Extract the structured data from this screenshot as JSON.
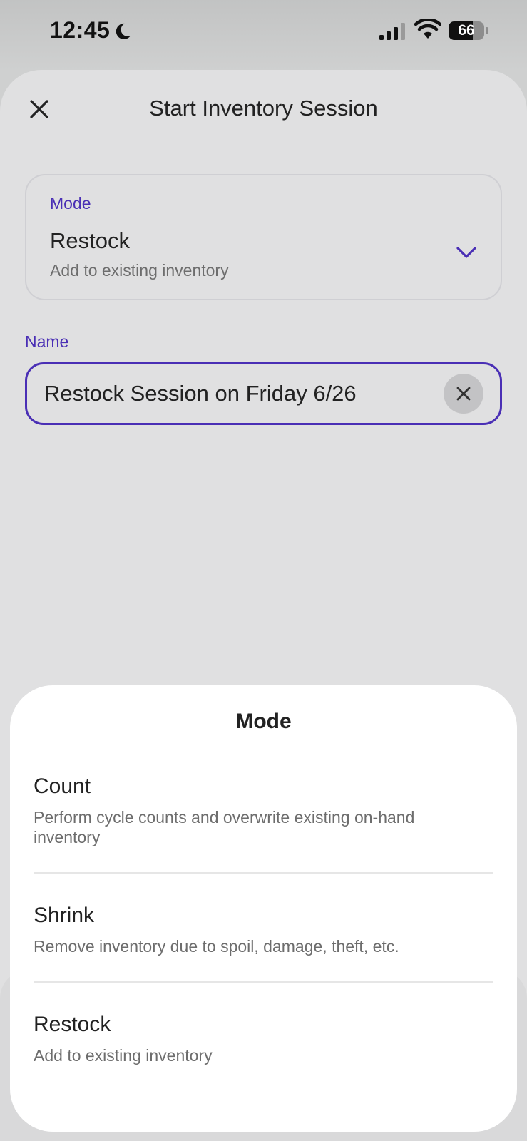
{
  "status_bar": {
    "time": "12:45",
    "battery": "66"
  },
  "header": {
    "title": "Start Inventory Session"
  },
  "mode_field": {
    "label": "Mode",
    "value": "Restock",
    "description": "Add to existing inventory"
  },
  "name_field": {
    "label": "Name",
    "value": "Restock Session on Friday 6/26"
  },
  "mode_sheet": {
    "title": "Mode",
    "options": [
      {
        "title": "Count",
        "description": "Perform cycle counts and overwrite existing on-hand inventory"
      },
      {
        "title": "Shrink",
        "description": "Remove inventory due to spoil, damage, theft, etc."
      },
      {
        "title": "Restock",
        "description": "Add to existing inventory"
      }
    ]
  },
  "colors": {
    "accent": "#4a2fb5",
    "sheet_background": "#e0e0e1",
    "modal_background": "#ffffff"
  },
  "icons": [
    "moon-icon",
    "signal-icon",
    "wifi-icon",
    "battery-icon",
    "close-icon",
    "chevron-down-icon",
    "clear-icon"
  ]
}
